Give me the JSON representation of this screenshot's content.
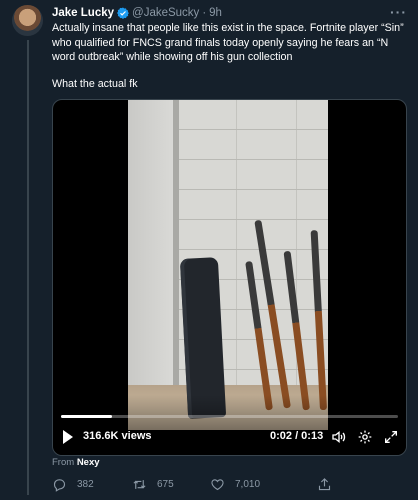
{
  "tweet": {
    "author_name": "Jake Lucky",
    "handle": "@JakeSucky",
    "separator": "·",
    "time": "9h",
    "more": "···",
    "text_line1": "Actually insane that people like this exist in the space. Fortnite player “Sin” who qualified for FNCS grand finals today openly saying he fears an “N word outbreak” while showing off his gun collection",
    "text_line2": "What the actual fk"
  },
  "media": {
    "views": "316.6K views",
    "timer": "0:02 / 0:13",
    "progress": 0.15
  },
  "from": {
    "prefix": "From",
    "source": "Nexy"
  },
  "actions": {
    "replies": "382",
    "retweets": "675",
    "likes": "7,010"
  },
  "colors": {
    "background": "#15202b",
    "secondary_text": "#8b98a5",
    "verified": "#1d9bf0",
    "border": "#38444d"
  }
}
